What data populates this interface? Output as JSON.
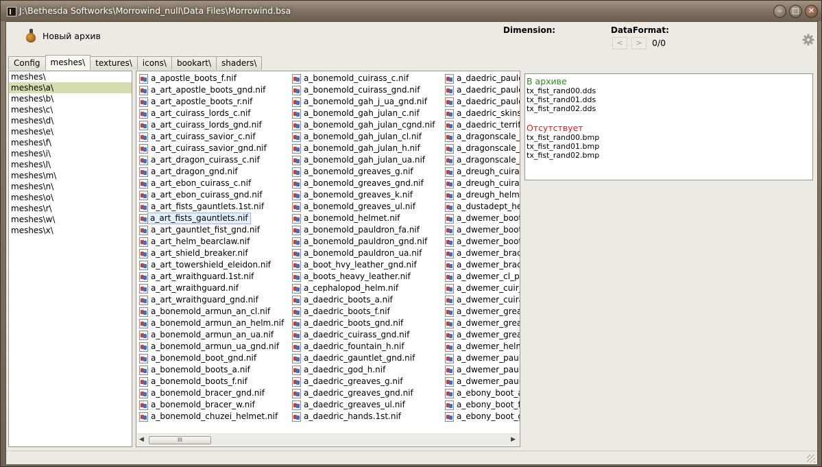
{
  "window": {
    "title": "J:\\Bethesda Softworks\\Morrowind_null\\Data Files\\Morrowind.bsa",
    "min": "–",
    "max": "□",
    "close": "✕"
  },
  "toolbar": {
    "new_archive": "Новый архив",
    "dimension_label": "Dimension:",
    "dataformat_label": "DataFormat:",
    "prev": "<",
    "next": ">",
    "counter": "0/0"
  },
  "tabs": [
    "Config",
    "meshes\\",
    "textures\\",
    "icons\\",
    "bookart\\",
    "shaders\\"
  ],
  "tree": [
    "meshes\\",
    "meshes\\a\\",
    "meshes\\b\\",
    "meshes\\c\\",
    "meshes\\d\\",
    "meshes\\e\\",
    "meshes\\f\\",
    "meshes\\i\\",
    "meshes\\l\\",
    "meshes\\m\\",
    "meshes\\n\\",
    "meshes\\o\\",
    "meshes\\r\\",
    "meshes\\w\\",
    "meshes\\x\\"
  ],
  "files": {
    "col1": [
      "a_apostle_boots_f.nif",
      "a_art_apostle_boots_gnd.nif",
      "a_art_apostle_boots_r.nif",
      "a_art_cuirass_lords_c.nif",
      "a_art_cuirass_lords_gnd.nif",
      "a_art_cuirass_savior_c.nif",
      "a_art_cuirass_savior_gnd.nif",
      "a_art_dragon_cuirass_c.nif",
      "a_art_dragon_gnd.nif",
      "a_art_ebon_cuirass_c.nif",
      "a_art_ebon_cuirass_gnd.nif",
      "a_art_fists_gauntlets.1st.nif",
      "a_art_fists_gauntlets.nif",
      "a_art_gauntlet_fist_gnd.nif",
      "a_art_helm_bearclaw.nif",
      "a_art_shield_breaker.nif",
      "a_art_towershield_eleidon.nif",
      "a_art_wraithguard.1st.nif",
      "a_art_wraithguard.nif",
      "a_art_wraithguard_gnd.nif",
      "a_bonemold_armun_an_cl.nif",
      "a_bonemold_armun_an_helm.nif",
      "a_bonemold_armun_an_ua.nif",
      "a_bonemold_armun_ua_gnd.nif",
      "a_bonemold_boot_gnd.nif",
      "a_bonemold_boots_a.nif",
      "a_bonemold_boots_f.nif",
      "a_bonemold_bracer_gnd.nif",
      "a_bonemold_bracer_w.nif",
      "a_bonemold_chuzei_helmet.nif"
    ],
    "col2": [
      "a_bonemold_cuirass_c.nif",
      "a_bonemold_cuirass_gnd.nif",
      "a_bonemold_gah_j_ua_gnd.nif",
      "a_bonemold_gah_julan_c.nif",
      "a_bonemold_gah_julan_cgnd.nif",
      "a_bonemold_gah_julan_cl.nif",
      "a_bonemold_gah_julan_h.nif",
      "a_bonemold_gah_julan_ua.nif",
      "a_bonemold_greaves_g.nif",
      "a_bonemold_greaves_gnd.nif",
      "a_bonemold_greaves_k.nif",
      "a_bonemold_greaves_ul.nif",
      "a_bonemold_helmet.nif",
      "a_bonemold_pauldron_fa.nif",
      "a_bonemold_pauldron_gnd.nif",
      "a_bonemold_pauldron_ua.nif",
      "a_boot_hvy_leather_gnd.nif",
      "a_boots_heavy_leather.nif",
      "a_cephalopod_helm.nif",
      "a_daedric_boots_a.nif",
      "a_daedric_boots_f.nif",
      "a_daedric_boots_gnd.nif",
      "a_daedric_cuirass_gnd.nif",
      "a_daedric_fountain_h.nif",
      "a_daedric_gauntlet_gnd.nif",
      "a_daedric_god_h.nif",
      "a_daedric_greaves_g.nif",
      "a_daedric_greaves_gnd.nif",
      "a_daedric_greaves_ul.nif",
      "a_daedric_hands.1st.nif"
    ],
    "col3": [
      "a_daedric_pauldro",
      "a_daedric_pauldro",
      "a_daedric_pauldro",
      "a_daedric_skins.ni",
      "a_daedric_terrifyir",
      "a_dragonscale_cu",
      "a_dragonscale_cu",
      "a_dragonscale_he",
      "a_dreugh_cuirass.",
      "a_dreugh_cuirass_",
      "a_dreugh_helm.ni",
      "a_dustadept_helm",
      "a_dwemer_boots_",
      "a_dwemer_boots_",
      "a_dwemer_boots_",
      "a_dwemer_bracer_",
      "a_dwemer_bracer.",
      "a_dwemer_cl_pau",
      "a_dwemer_cuir_g",
      "a_dwemer_cuirass",
      "a_dwemer_greave",
      "a_dwemer_greave",
      "a_dwemer_greave",
      "a_dwemer_helme",
      "a_dwemer_pauldr",
      "a_dwemer_pauldr",
      "a_dwemer_pauldr",
      "a_ebony_boot_a.r",
      "a_ebony_boot_f.n",
      "a_ebony_boot_gn"
    ]
  },
  "scrollbar_thumb": "III",
  "info": {
    "in_archive_title": "В архиве",
    "in_archive": [
      "tx_fist_rand00.dds",
      "tx_fist_rand01.dds",
      "tx_fist_rand02.dds"
    ],
    "missing_title": "Отсутствует",
    "missing": [
      "tx_fist_rand00.bmp",
      "tx_fist_rand01.bmp",
      "tx_fist_rand02.bmp"
    ]
  },
  "colors": {
    "in_archive": "#2e8b1e",
    "missing": "#e02020",
    "tree_selected": "#d9dcb1",
    "file_selected": "#e5eefb"
  },
  "state": {
    "active_tab": "meshes\\",
    "selected_tree_item": "meshes\\a\\",
    "selected_file": "a_art_fists_gauntlets.nif"
  }
}
